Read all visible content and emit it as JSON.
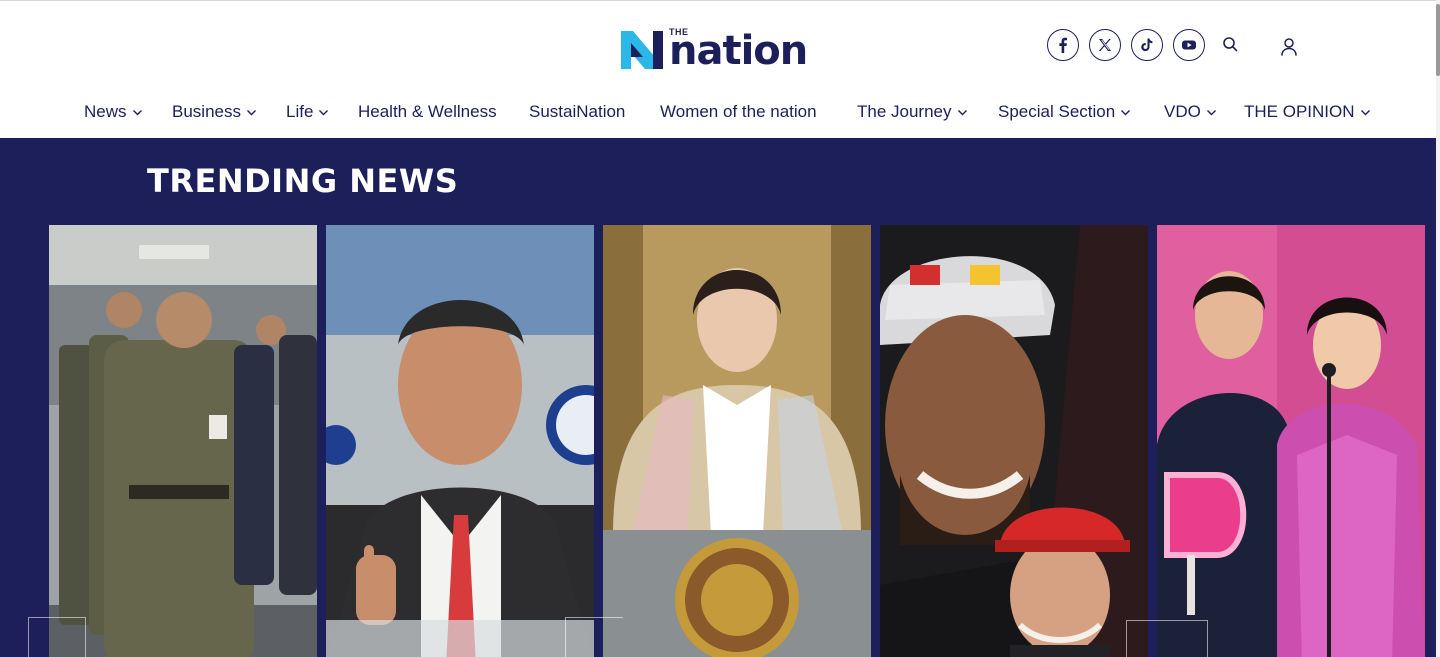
{
  "header": {
    "logo_small": "THE",
    "logo_word": "nation",
    "social_icons": [
      "facebook-icon",
      "x-icon",
      "tiktok-icon",
      "youtube-icon"
    ],
    "search_icon": "search-icon",
    "user_icon": "user-icon"
  },
  "nav": {
    "items": [
      {
        "label": "News",
        "has_dropdown": true
      },
      {
        "label": "Business",
        "has_dropdown": true
      },
      {
        "label": "Life",
        "has_dropdown": true
      },
      {
        "label": "Health & Wellness",
        "has_dropdown": false
      },
      {
        "label": "SustaiNation",
        "has_dropdown": false
      },
      {
        "label": "Women of the nation",
        "has_dropdown": false
      },
      {
        "label": "The Journey",
        "has_dropdown": true
      },
      {
        "label": "Special Section",
        "has_dropdown": true
      },
      {
        "label": "VDO",
        "has_dropdown": true
      },
      {
        "label": "THE OPINION",
        "has_dropdown": true
      }
    ]
  },
  "trending": {
    "title": "TRENDING NEWS"
  },
  "colors": {
    "brand_navy": "#1c1f5a",
    "brand_cyan": "#2cb8e6",
    "background": "#ffffff"
  }
}
